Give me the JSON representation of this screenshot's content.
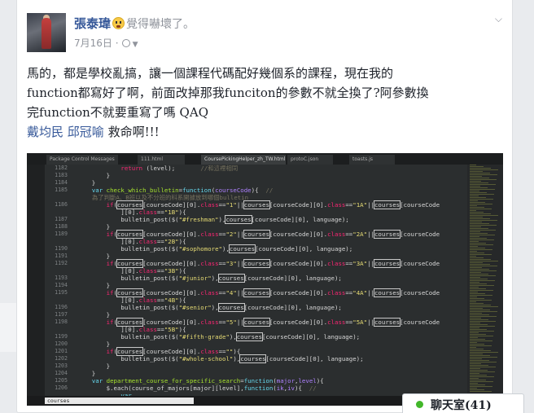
{
  "post": {
    "author": "張泰瑋",
    "feeling": "覺得嚇壞了。",
    "date": "7月16日",
    "separator": "·",
    "body_lines": [
      "馬的，都是學校亂搞，讓一個課程代碼配好幾個系的課程，現在我的",
      "function都寫好了啊，前面改掉那我funciton的參數不就全換了?阿參數換",
      "完function不就要重寫了嗎 QAQ"
    ],
    "tags": [
      "戴均民",
      "邱冠喻"
    ],
    "tag_suffix": "救命啊!!!"
  },
  "editor": {
    "tabs": [
      "Package Control Messages",
      "111.html",
      "CoursePickingHelper_zh_TW.html",
      "protoC.json",
      "toasts.js"
    ],
    "find_text": "courses",
    "line_numbers": [
      "1182",
      "1183",
      "1184",
      "1185",
      "",
      "1186",
      "",
      "1187",
      "1188",
      "1189",
      "",
      "1190",
      "1191",
      "1192",
      "",
      "1193",
      "1194",
      "1195",
      "",
      "1196",
      "1197",
      "1198",
      "",
      "1199",
      "1200",
      "1201",
      "1202",
      "1203",
      "1204",
      "1205",
      "1206"
    ]
  },
  "chat": {
    "label": "聊天室(41)"
  },
  "colors": {
    "link": "#365899",
    "editor_bg": "#2b2e2f",
    "online": "#42b72a"
  }
}
